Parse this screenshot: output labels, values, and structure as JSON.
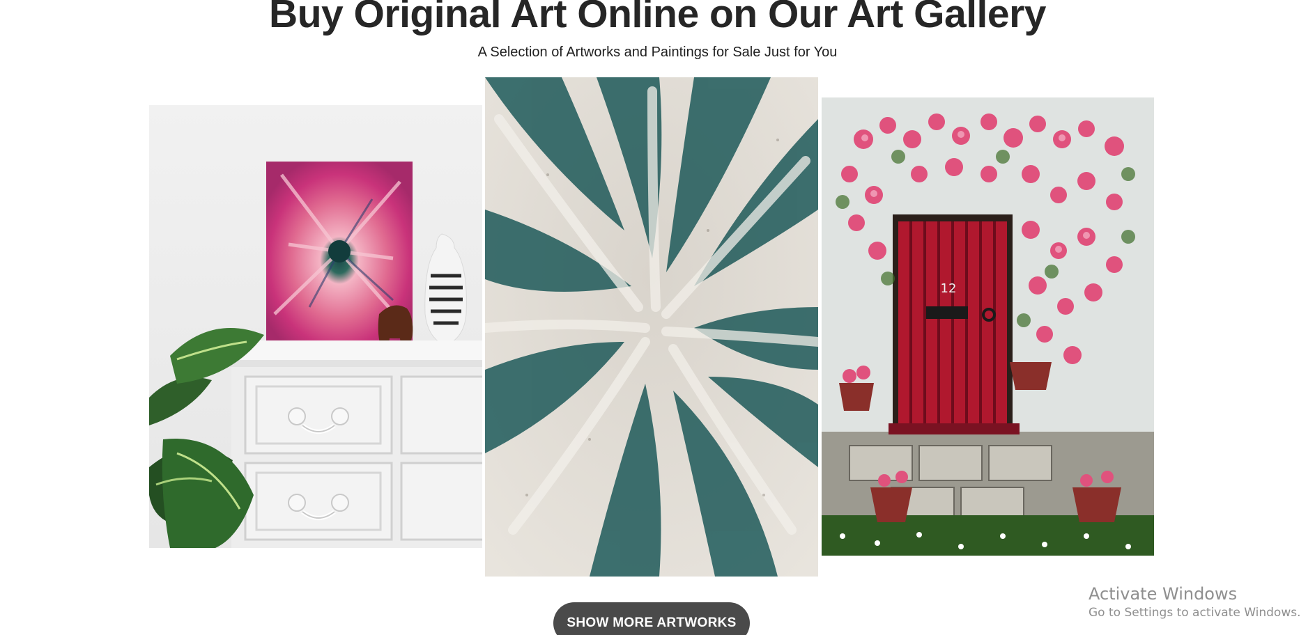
{
  "header": {
    "title": "Buy Original Art Online on Our Art Gallery",
    "subtitle": "A Selection of Artworks and Paintings for Sale Just for You"
  },
  "gallery": {
    "artworks": [
      {
        "description_icon": "pink-flower-canvas-on-dresser"
      },
      {
        "description_icon": "teal-abstract-brushstrokes"
      },
      {
        "description_icon": "red-door-with-pink-flowers"
      }
    ],
    "door_number": "12"
  },
  "actions": {
    "show_more_label": "SHOW MORE ARTWORKS"
  },
  "system_watermark": {
    "title": "Activate Windows",
    "subtitle": "Go to Settings to activate Windows."
  },
  "colors": {
    "button_bg": "#4a4a4a",
    "title_text": "#262626",
    "accent_pink": "#e0527d",
    "accent_teal": "#1f5a5a",
    "door_red": "#b0182e"
  }
}
